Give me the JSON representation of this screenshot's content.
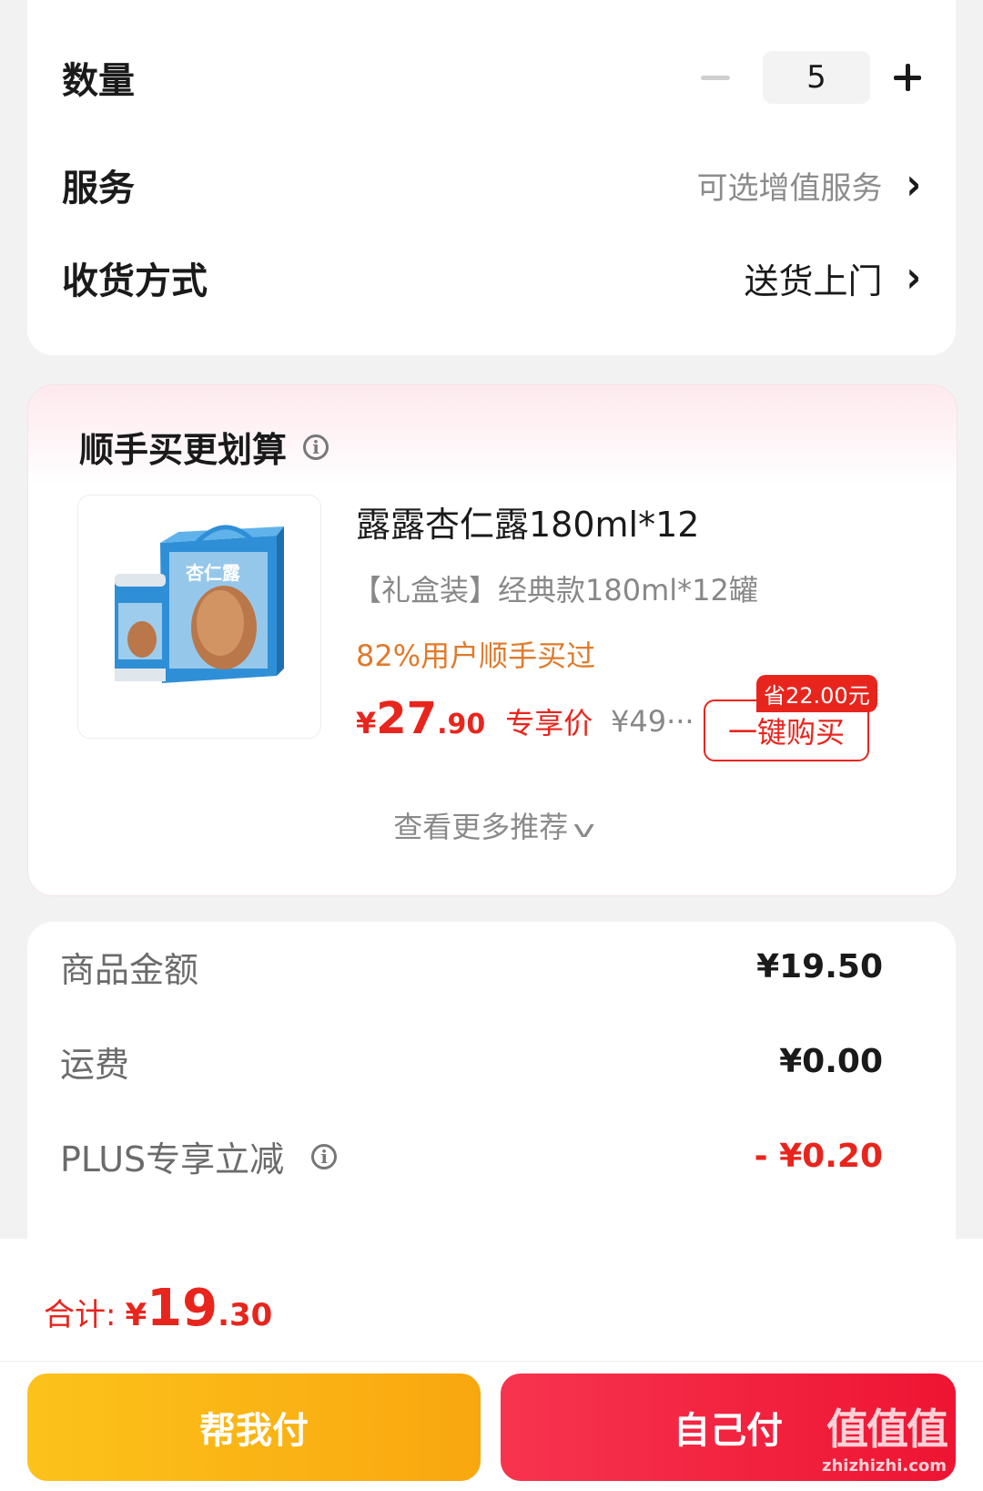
{
  "order": {
    "quantity_label": "数量",
    "quantity_value": "5",
    "service_label": "服务",
    "service_value": "可选增值服务",
    "delivery_label": "收货方式",
    "delivery_value": "送货上门"
  },
  "recommend": {
    "title": "顺手买更划算",
    "product_title": "露露杏仁露180ml*12",
    "product_subtitle": "【礼盒装】经典款180ml*12罐",
    "social_proof": "82%用户顺手买过",
    "price_symbol": "¥",
    "price_int": "27",
    "price_dec": ".90",
    "price_tag": "专享价",
    "original_price": "¥49···",
    "save_badge": "省22.00元",
    "buy_button": "一键购买",
    "more_link": "查看更多推荐",
    "image_text": "杏仁露"
  },
  "summary": {
    "goods_label": "商品金额",
    "goods_value": "¥19.50",
    "shipping_label": "运费",
    "shipping_value": "¥0.00",
    "plus_label": "PLUS专享立减",
    "plus_value": "- ¥0.20"
  },
  "bottom": {
    "total_label": "合计:",
    "total_symbol": "¥",
    "total_int": "19",
    "total_dec": ".30",
    "help_pay": "帮我付",
    "self_pay": "自己付",
    "watermark_big": "值值值",
    "watermark_small": "zhizhizhi.com"
  },
  "colors": {
    "accent_red": "#e8251d",
    "orange": "#e07a2a",
    "help_pay_yellow": "#fcc21b",
    "self_pay_red": "#f7344f"
  }
}
